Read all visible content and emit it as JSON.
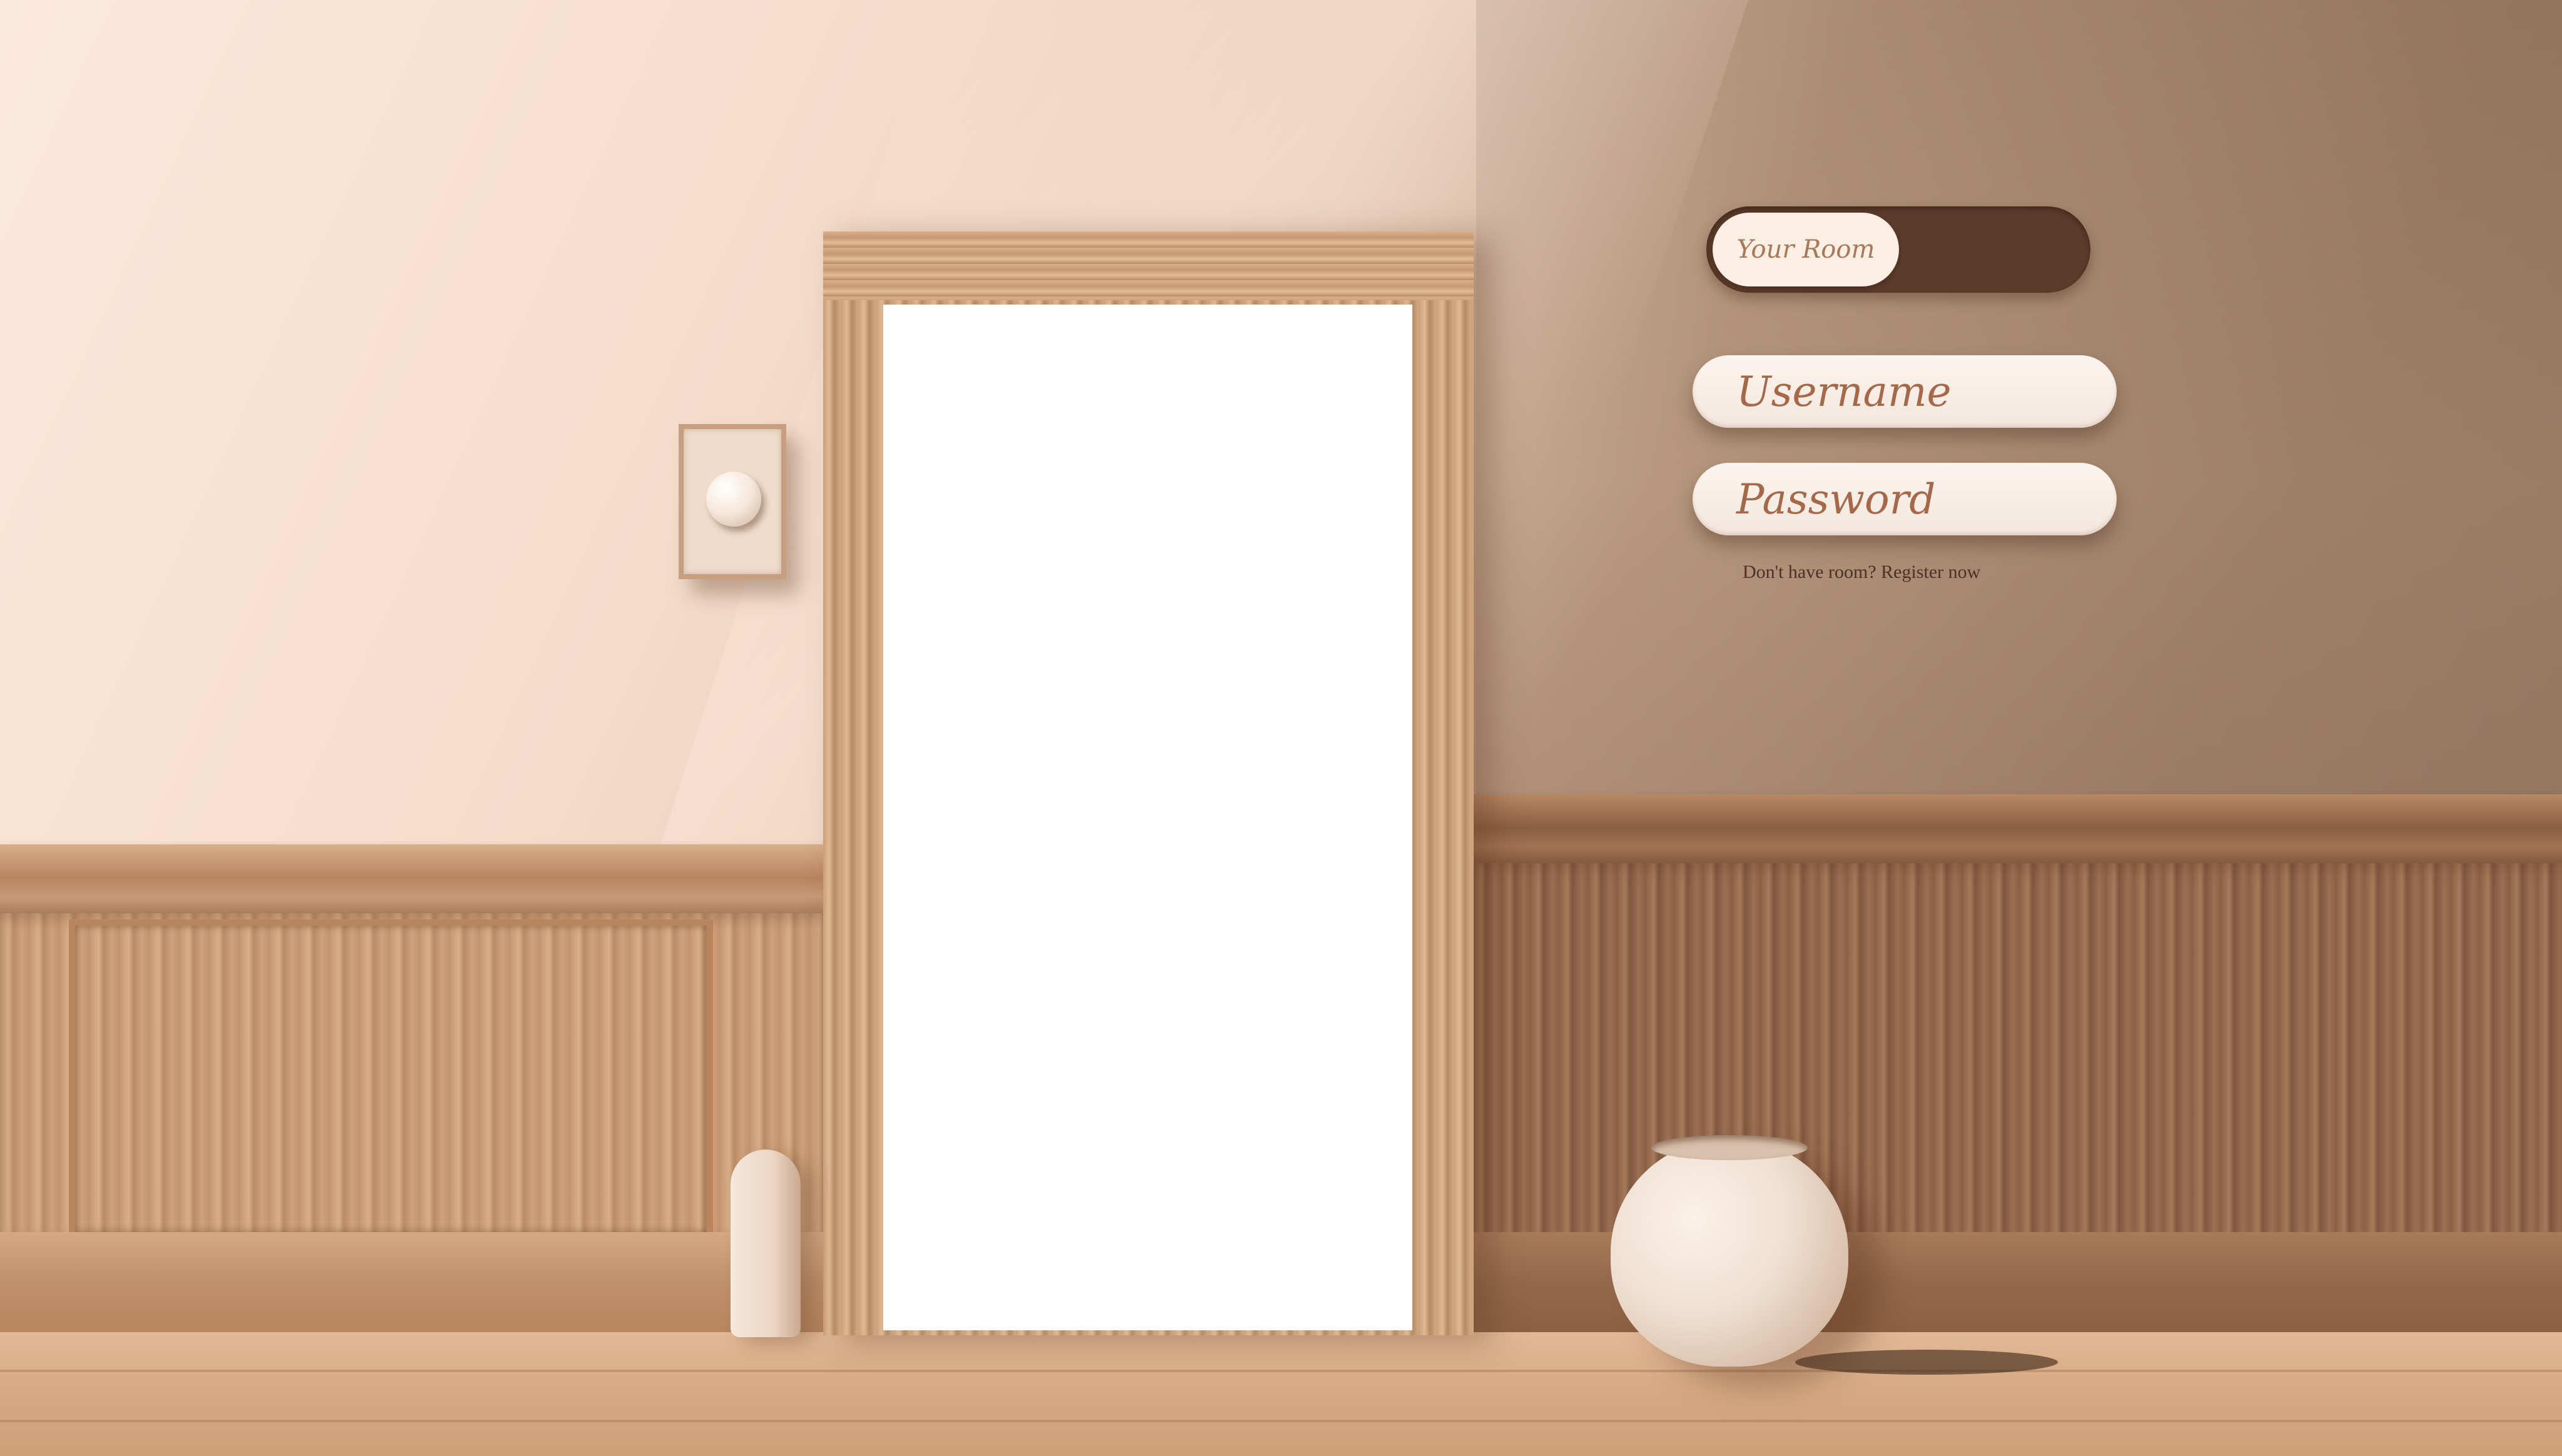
{
  "login": {
    "room_label": "Your Room",
    "username_placeholder": "Username",
    "password_placeholder": "Password",
    "register_text": "Don't have room? Register now"
  },
  "colors": {
    "toggle_track": "#5b3b2a",
    "toggle_pill": "#fbeee2",
    "field_background": "#f7ede4",
    "placeholder_text": "#a5694a",
    "link_text": "#4a3326"
  },
  "scene": {
    "illustration": [
      "doorway",
      "light-switch",
      "wainscoting",
      "small-vase",
      "round-vase"
    ]
  }
}
